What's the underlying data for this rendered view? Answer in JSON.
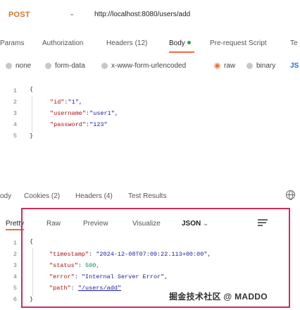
{
  "request": {
    "method": "POST",
    "url": "http://localhost:8080/users/add"
  },
  "request_tabs": [
    {
      "label": "Params"
    },
    {
      "label": "Authorization"
    },
    {
      "label": "Headers (12)"
    },
    {
      "label": "Body"
    },
    {
      "label": "Pre-request Script"
    },
    {
      "label": "Te"
    }
  ],
  "body_types": [
    {
      "label": "none"
    },
    {
      "label": "form-data"
    },
    {
      "label": "x-www-form-urlencoded"
    },
    {
      "label": "raw"
    },
    {
      "label": "binary"
    }
  ],
  "body_language": "JS",
  "request_body": {
    "line_numbers": [
      "1",
      "2",
      "3",
      "4",
      "5"
    ],
    "lines": [
      {
        "k": "\"id\"",
        "v": "\"1\","
      },
      {
        "k": "\"username\"",
        "v": "\"user1\","
      },
      {
        "k": "\"password\"",
        "v": "\"123\""
      }
    ],
    "open": "{",
    "close": "}"
  },
  "response_tabs": [
    {
      "label": "ody"
    },
    {
      "label": "Cookies (2)"
    },
    {
      "label": "Headers (4)"
    },
    {
      "label": "Test Results"
    }
  ],
  "view_tabs": [
    {
      "label": "Pretty"
    },
    {
      "label": "Raw"
    },
    {
      "label": "Preview"
    },
    {
      "label": "Visualize"
    }
  ],
  "format": "JSON",
  "response_body": {
    "line_numbers": [
      "1",
      "2",
      "3",
      "4",
      "5",
      "6"
    ],
    "open": "{",
    "close": "}",
    "timestamp_key": "\"timestamp\"",
    "timestamp_val": "\"2024-12-08T07:09:22.113+00:00\",",
    "status_key": "\"status\"",
    "status_val": "500,",
    "error_key": "\"error\"",
    "error_val": "\"Internal Server Error\",",
    "path_key": "\"path\"",
    "path_val": "\"/users/add\""
  },
  "watermark": "掘金技术社区 @ MADDO",
  "colors": {
    "accent": "#f26b3a",
    "method": "#d9742b",
    "highlight_border": "#c9305a"
  }
}
